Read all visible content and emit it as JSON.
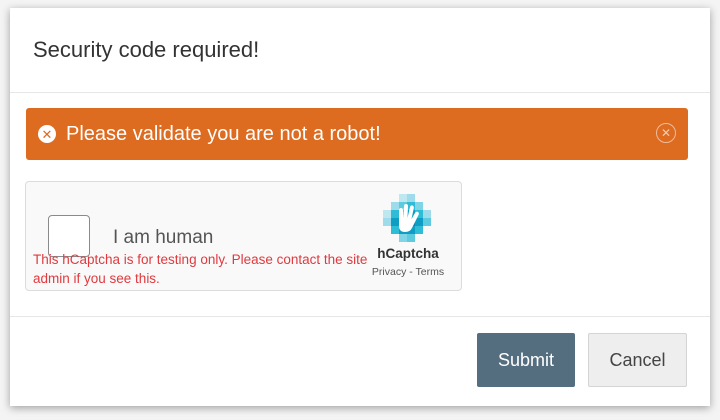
{
  "modal": {
    "title": "Security code required!"
  },
  "alert": {
    "message": "Please validate you are not a robot!",
    "icon": "error-circle-icon",
    "close_icon": "close-circle-icon",
    "color": "#dd6b20"
  },
  "captcha": {
    "checkbox_label": "I am human",
    "checked": false,
    "warning": "This hCaptcha is for testing only. Please contact the site admin if you see this.",
    "brand": "hCaptcha",
    "privacy_link": "Privacy",
    "separator": " - ",
    "terms_link": "Terms",
    "warning_color": "#e0393e"
  },
  "footer": {
    "submit_label": "Submit",
    "cancel_label": "Cancel",
    "submit_color": "#546e80"
  }
}
